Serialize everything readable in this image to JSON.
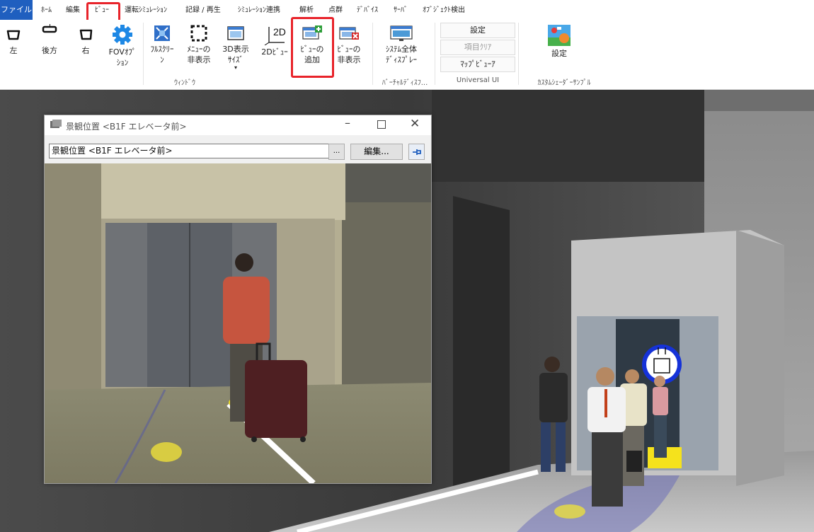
{
  "tabs": [
    "ファイル",
    "ﾎｰﾑ",
    "編集",
    "ﾋﾞｭｰ",
    "運転ｼﾐｭﾚｰｼｮﾝ",
    "記録 / 再生",
    "ｼﾐｭﾚｰｼｮﾝ連携",
    "解析",
    "点群",
    "ﾃﾞﾊﾞｲｽ",
    "ｻｰﾊﾞ",
    "ｵﾌﾞｼﾞｪｸﾄ検出"
  ],
  "ribbon": {
    "left": "左",
    "back": "後方",
    "right": "右",
    "fov": [
      "FOVｵﾌﾟ",
      "ｼｮﾝ"
    ],
    "fullscreen": [
      "ﾌﾙｽｸﾘｰ",
      "ﾝ"
    ],
    "menu_hide": [
      "ﾒﾆｭｰの",
      "非表示"
    ],
    "size3d": [
      "3D表示",
      "ｻｲｽﾞ"
    ],
    "view2d": "2Dﾋﾞｭｰ",
    "add_view": [
      "ﾋﾞｭｰの",
      "追加"
    ],
    "hide_view": [
      "ﾋﾞｭｰの",
      "非表示"
    ],
    "system_display": [
      "ｼｽﾃﾑ全体",
      "ﾃﾞｨｽﾌﾟﾚｰ"
    ],
    "settings": "設定",
    "clear_items": "項目ｸﾘｱ",
    "map_viewer": "ﾏｯﾌﾟﾋﾞｭｰｱ",
    "shader_settings": "設定",
    "group_window": "ｳｨﾝﾄﾞｳ",
    "group_virtual": "ﾊﾞｰﾁｬﾙﾃﾞｨｽﾌ...",
    "group_universal": "Universal UI",
    "group_shader": "ｶｽﾀﾑｼｪｰﾀﾞｰｻﾝﾌﾟﾙ",
    "icon_2d": "2D"
  },
  "subwindow": {
    "title": "景観位置 <B1F エレベータ前>",
    "field_value": "景観位置 <B1F エレベータ前>",
    "browse": "...",
    "edit": "編集..."
  },
  "colors": {
    "accent": "#1f5fbf",
    "highlight": "#e8232a"
  }
}
